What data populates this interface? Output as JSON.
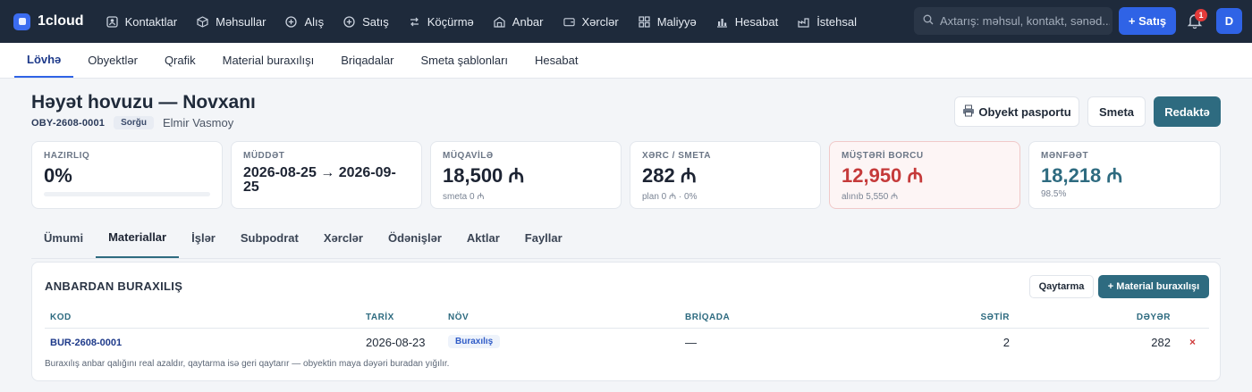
{
  "app": {
    "brand": "1cloud",
    "brand_color": "#3b6cf0"
  },
  "topnav": {
    "items": [
      {
        "label": "Kontaktlar",
        "icon": "contacts-icon"
      },
      {
        "label": "Məhsullar",
        "icon": "box-icon"
      },
      {
        "label": "Alış",
        "icon": "plus-circle-icon"
      },
      {
        "label": "Satış",
        "icon": "plus-circle-icon"
      },
      {
        "label": "Köçürmə",
        "icon": "transfer-icon"
      },
      {
        "label": "Anbar",
        "icon": "warehouse-icon"
      },
      {
        "label": "Xərclər",
        "icon": "wallet-icon"
      },
      {
        "label": "Maliyyə",
        "icon": "grid-icon"
      },
      {
        "label": "Hesabat",
        "icon": "bar-chart-icon"
      },
      {
        "label": "İstehsal",
        "icon": "factory-icon"
      }
    ],
    "search_placeholder": "Axtarış: məhsul, kontakt, sənəd...",
    "sale_button": "+ Satış",
    "notifications_count": "1",
    "avatar_initial": "D"
  },
  "subnav": {
    "tabs": [
      "Lövhə",
      "Obyektlər",
      "Qrafik",
      "Material buraxılışı",
      "Briqadalar",
      "Smeta şablonları",
      "Hesabat"
    ],
    "active": 0
  },
  "header": {
    "title": "Həyət hovuzu — Novxanı",
    "code": "OBY-2608-0001",
    "status": "Sorğu",
    "person": "Elmir Vasmoy",
    "btn_passport": "Obyekt pasportu",
    "btn_estimate": "Smeta",
    "btn_edit": "Redaktə"
  },
  "stats": [
    {
      "label": "HAZIRLIQ",
      "value": "0%",
      "progress": 0
    },
    {
      "label": "MÜDDƏT",
      "value": "2026-08-25 → 2026-09-25"
    },
    {
      "label": "MÜQAVİLƏ",
      "value": "18,500 ₼",
      "sub": "smeta 0 ₼"
    },
    {
      "label": "XƏRC / SMETA",
      "value": "282 ₼",
      "sub": "plan 0 ₼ · 0%"
    },
    {
      "label": "MÜŞTƏRİ BORCU",
      "value": "12,950 ₼",
      "sub": "alınıb 5,550 ₼"
    },
    {
      "label": "MƏNFƏƏT",
      "value": "18,218 ₼",
      "sub": "98.5%"
    }
  ],
  "content_tabs": {
    "tabs": [
      "Ümumi",
      "Materiallar",
      "İşlər",
      "Subpodrat",
      "Xərclər",
      "Ödənişlər",
      "Aktlar",
      "Fayllar"
    ],
    "active": 1
  },
  "panel": {
    "title": "ANBARDAN BURAXILIŞ",
    "btn_return": "Qaytarma",
    "btn_new": "+ Material buraxılışı",
    "columns": [
      "KOD",
      "TARİX",
      "NÖV",
      "BRİQADA",
      "SƏTİR",
      "DƏYƏR"
    ],
    "rows": [
      {
        "code": "BUR-2608-0001",
        "date": "2026-08-23",
        "type": "Buraxılış",
        "team": "—",
        "lines": "2",
        "value": "282"
      }
    ],
    "note": "Buraxılış anbar qalığını real azaldır, qaytarma isə geri qaytarır — obyektin maya dəyəri buradan yığılır."
  },
  "colors": {
    "topnav_bg": "#1e2a3b",
    "primary": "#2f63e6",
    "accent": "#2e6b80",
    "danger": "#c53a3a"
  }
}
